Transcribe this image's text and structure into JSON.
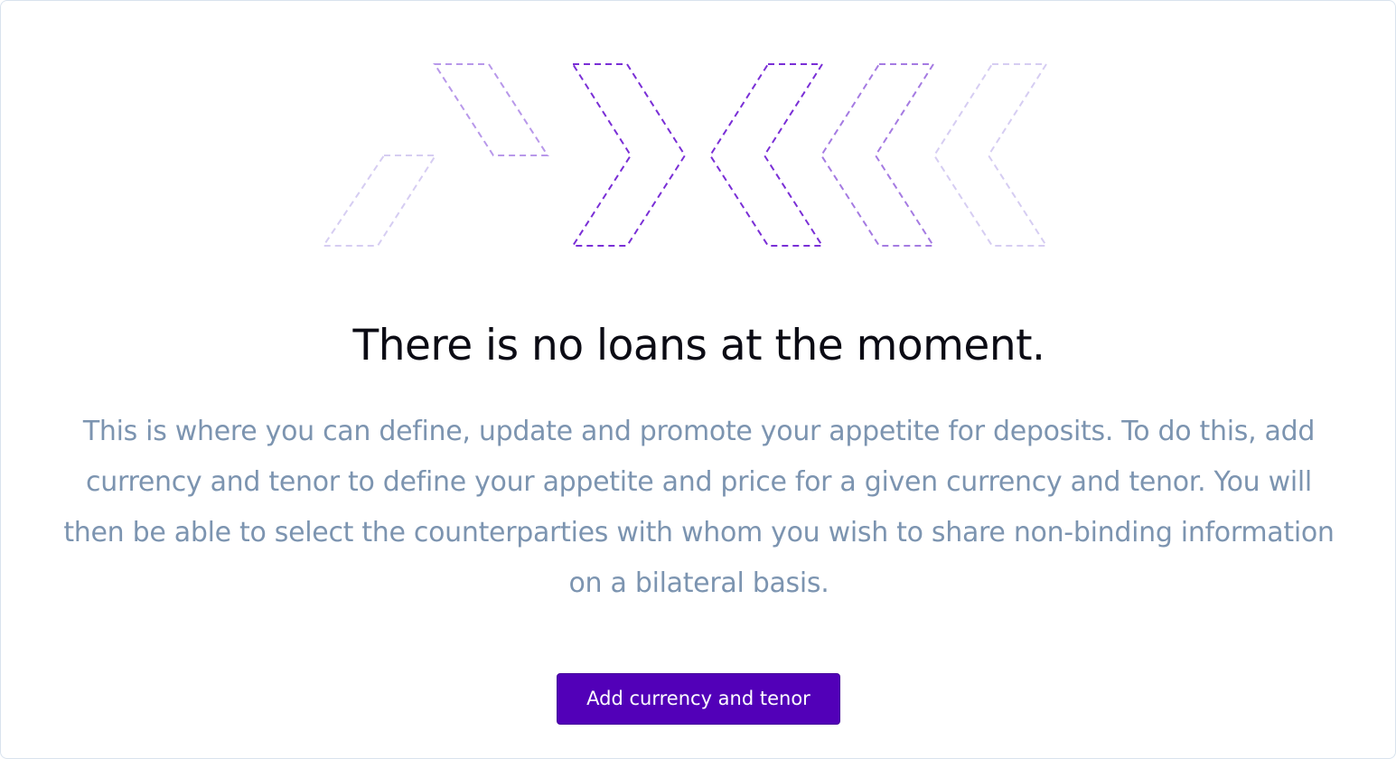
{
  "empty_state": {
    "title": "There is no loans at the moment.",
    "description": "This is where you can define, update and promote your appetite for deposits. To do this, add currency and tenor to define your appetite and price for a given currency and tenor. You will then be able to select the counterparties with whom you wish to share non-binding information on a bilateral basis.",
    "illustration_icon": "dashed-chevrons-illustration",
    "action_button_label": "Add currency and tenor"
  },
  "colors": {
    "accent": "#5200b8",
    "title": "#0b0b14",
    "description": "#7c94b0",
    "chevron_strong": "#7a2fd6",
    "chevron_medium": "#a57be2",
    "chevron_light": "#d6cdf2",
    "card_border": "#d9e3ee"
  }
}
